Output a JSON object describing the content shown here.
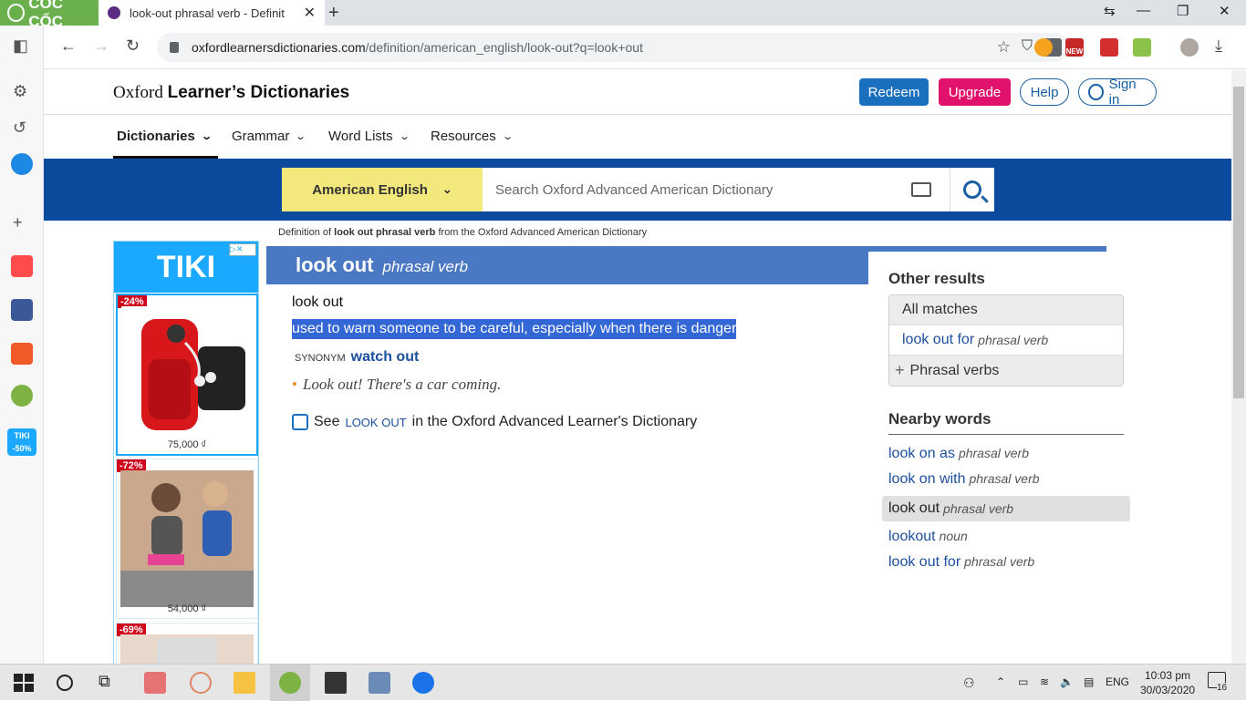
{
  "browser": {
    "brand": "CỐC CỐC",
    "tab_title": "look-out phrasal verb - Definit",
    "url_domain": "oxfordlearnersdictionaries.com",
    "url_path": "/definition/american_english/look-out?q=look+out",
    "new_badge": "NEW"
  },
  "sidebar_tiki": "TIKI -50%",
  "header": {
    "logo_a": "Oxford",
    "logo_b": "Learner’s Dictionaries",
    "redeem": "Redeem",
    "upgrade": "Upgrade",
    "help": "Help",
    "signin": "Sign in"
  },
  "menu": [
    "Dictionaries",
    "Grammar",
    "Word Lists",
    "Resources"
  ],
  "search": {
    "dictionary": "American English",
    "placeholder": "Search Oxford Advanced American Dictionary"
  },
  "definition_note": {
    "prefix": "Definition of",
    "term": "look out phrasal verb",
    "suffix": "from the Oxford Advanced American Dictionary"
  },
  "ad": {
    "brand": "TIKI",
    "products": [
      {
        "discount": "-24%",
        "price": "75,000 ₫"
      },
      {
        "discount": "-72%",
        "price": "54,000 ₫"
      },
      {
        "discount": "-69%",
        "price": ""
      }
    ]
  },
  "entry": {
    "headword": "look out",
    "pos": "phrasal verb",
    "phrase": "look out",
    "definition": "used to warn someone to be careful, especially when there is danger",
    "synonym_label": "SYNONYM",
    "synonym": "watch out",
    "example": "Look out! There's a car coming.",
    "see_prefix": "See",
    "see_link": "look out",
    "see_suffix": "in the Oxford Advanced Learner's Dictionary"
  },
  "other_results": {
    "heading": "Other results",
    "all_matches": "All matches",
    "match_word": "look out for",
    "match_pos": "phrasal verb",
    "phrasal_verbs": "Phrasal verbs"
  },
  "nearby": {
    "heading": "Nearby words",
    "words": [
      {
        "word": "look on as",
        "pos": "phrasal verb"
      },
      {
        "word": "look on with",
        "pos": "phrasal verb"
      },
      {
        "word": "look out",
        "pos": "phrasal verb"
      },
      {
        "word": "lookout",
        "pos": "noun"
      },
      {
        "word": "look out for",
        "pos": "phrasal verb"
      }
    ]
  },
  "taskbar": {
    "lang": "ENG",
    "time": "10:03 pm",
    "date": "30/03/2020",
    "notif_count": "16"
  }
}
